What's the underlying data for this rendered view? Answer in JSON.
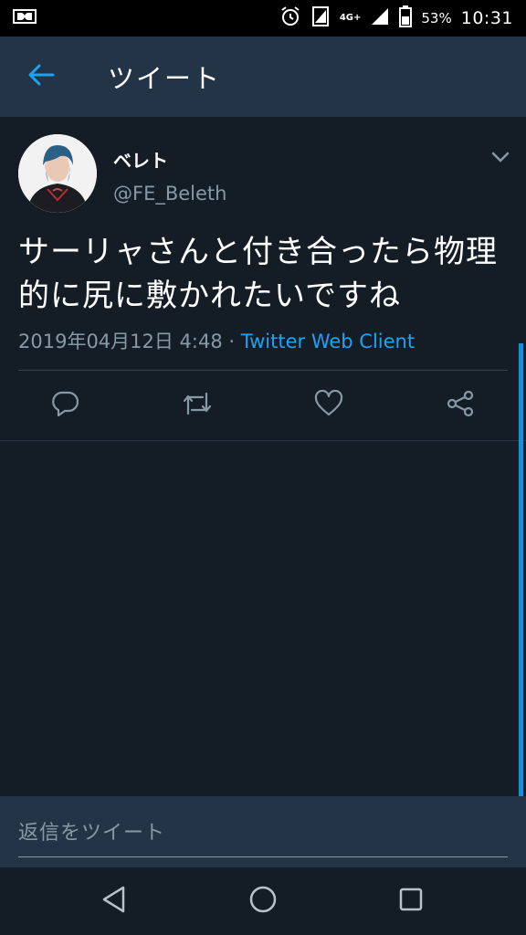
{
  "status_bar": {
    "battery_percent": "53%",
    "time": "10:31",
    "network": "4G+"
  },
  "header": {
    "title": "ツイート"
  },
  "tweet": {
    "author_name": "ベレト",
    "author_handle": "@FE_Beleth",
    "text": "サーリャさんと付き合ったら物理的に尻に敷かれたいですね",
    "timestamp": "2019年04月12日 4:48",
    "separator": " · ",
    "source": "Twitter Web Client"
  },
  "icons": {
    "back": "arrow-left-icon",
    "caret": "chevron-down-icon",
    "reply": "reply-icon",
    "retweet": "retweet-icon",
    "like": "heart-icon",
    "share": "share-icon"
  },
  "reply_bar": {
    "placeholder": "返信をツイート"
  },
  "colors": {
    "background": "#141d26",
    "header": "#243447",
    "accent": "#1da1f2",
    "muted": "#8899a6"
  }
}
